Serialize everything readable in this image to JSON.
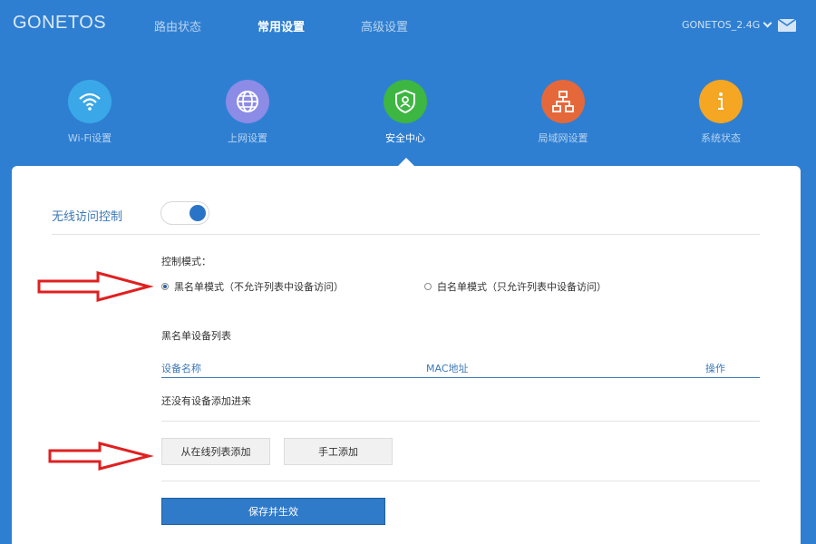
{
  "brand": "GONETOS",
  "nav_tabs": [
    {
      "label": "路由状态",
      "active": false
    },
    {
      "label": "常用设置",
      "active": true
    },
    {
      "label": "高级设置",
      "active": false
    }
  ],
  "ssid_selector": "GONETOS_2.4G",
  "features": [
    {
      "label": "Wi-Fi设置",
      "icon": "wifi-icon",
      "color": "#3aa8e8"
    },
    {
      "label": "上网设置",
      "icon": "globe-icon",
      "color": "#8c8be6"
    },
    {
      "label": "安全中心",
      "icon": "shield-user-icon",
      "color": "#3db642",
      "active": true
    },
    {
      "label": "局域网设置",
      "icon": "network-icon",
      "color": "#e5683a"
    },
    {
      "label": "系统状态",
      "icon": "info-icon",
      "color": "#f5a623"
    }
  ],
  "wireless_access_control": {
    "label": "无线访问控制",
    "enabled": true
  },
  "control_mode": {
    "label": "控制模式：",
    "options": [
      {
        "label": "黑名单模式（不允许列表中设备访问）",
        "selected": true
      },
      {
        "label": "白名单模式（只允许列表中设备访问）",
        "selected": false
      }
    ]
  },
  "blacklist": {
    "title": "黑名单设备列表",
    "columns": [
      "设备名称",
      "MAC地址",
      "操作"
    ],
    "empty_text": "还没有设备添加进来"
  },
  "buttons": {
    "add_from_online": "从在线列表添加",
    "add_manual": "手工添加",
    "save": "保存并生效"
  },
  "annotation_color": "#e02020"
}
